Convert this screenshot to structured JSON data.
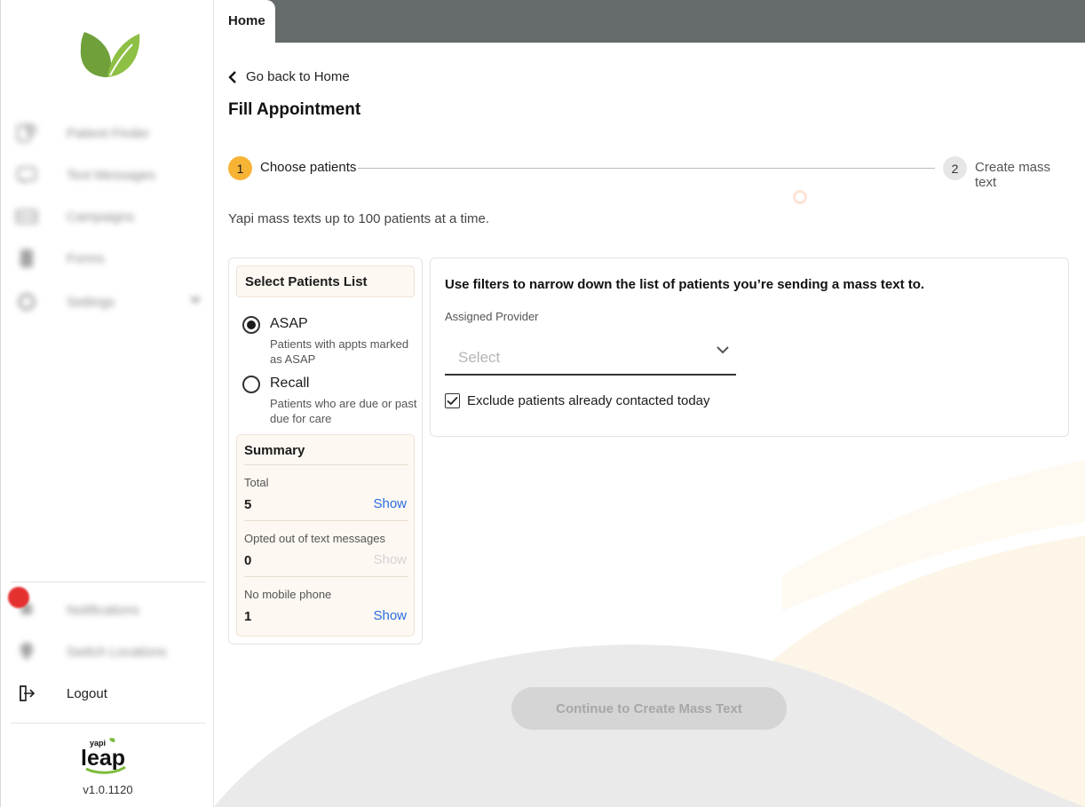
{
  "sidebar": {
    "items": [
      {
        "label": "Patient Finder",
        "icon": "patient-finder-icon"
      },
      {
        "label": "Text Messages",
        "icon": "text-messages-icon"
      },
      {
        "label": "Campaigns",
        "icon": "campaigns-icon"
      },
      {
        "label": "Forms",
        "icon": "forms-icon"
      },
      {
        "label": "Settings",
        "icon": "settings-icon"
      }
    ],
    "bottom_items": [
      {
        "label": "Notifications",
        "icon": "bell-icon"
      },
      {
        "label": "Switch Locations",
        "icon": "location-icon"
      },
      {
        "label": "Logout",
        "icon": "logout-icon"
      }
    ],
    "version": "v1.0.1120"
  },
  "topbar": {
    "tab_label": "Home"
  },
  "main": {
    "back_label": "Go back to Home",
    "title": "Fill Appointment",
    "steps": [
      {
        "number": "1",
        "label": "Choose patients"
      },
      {
        "number": "2",
        "label": "Create mass text"
      }
    ],
    "intro": "Yapi mass texts up to 100 patients at a time.",
    "patients_list": {
      "header": "Select Patients List",
      "options": [
        {
          "title": "ASAP",
          "desc": "Patients with appts marked as ASAP"
        },
        {
          "title": "Recall",
          "desc": "Patients who are due or past due for care"
        }
      ]
    },
    "summary": {
      "title": "Summary",
      "rows": [
        {
          "label": "Total",
          "value": "5",
          "action": "Show"
        },
        {
          "label": "Opted out of text messages",
          "value": "0",
          "action": "Show"
        },
        {
          "label": "No mobile phone",
          "value": "1",
          "action": "Show"
        }
      ]
    },
    "filters": {
      "heading": "Use filters to narrow down the list of patients you’re sending a mass text to.",
      "provider_label": "Assigned Provider",
      "provider_placeholder": "Select",
      "exclude_label": "Exclude patients already contacted today"
    },
    "cta_label": "Continue to Create Mass Text"
  },
  "colors": {
    "accent": "#f6b334",
    "link": "#2b6cdf",
    "topbar": "#656b6a",
    "notification": "#e53030"
  }
}
